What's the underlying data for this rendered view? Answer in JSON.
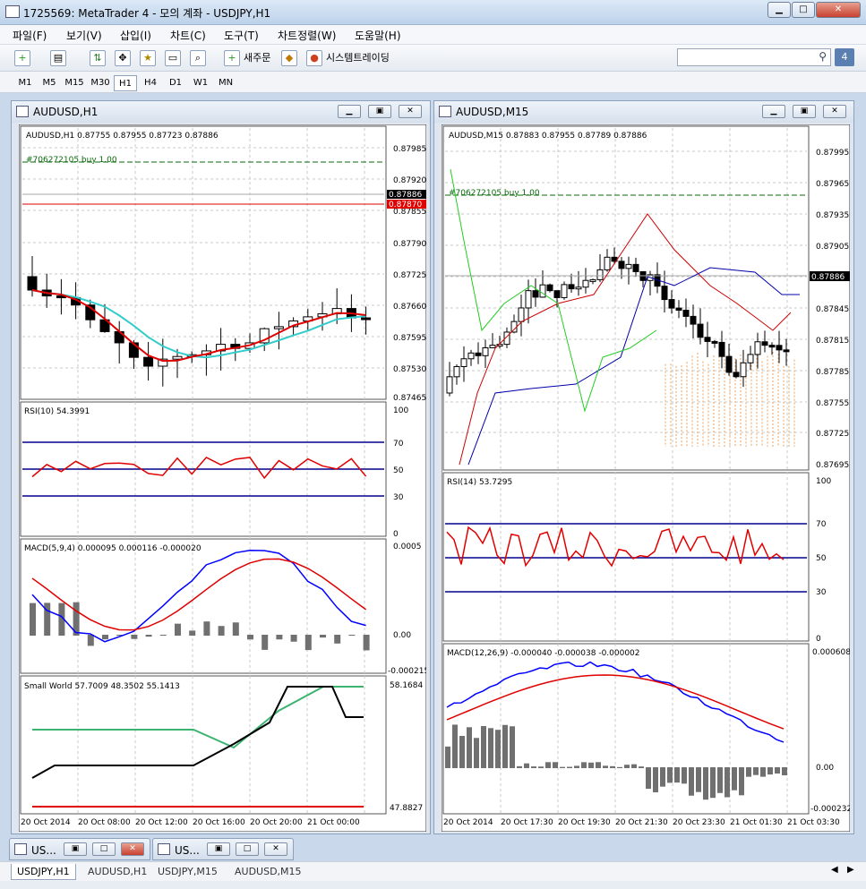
{
  "window": {
    "title": "1725569: MetaTrader 4 - 모의 계좌 - USDJPY,H1"
  },
  "menu": [
    "파일(F)",
    "보기(V)",
    "삽입(I)",
    "차트(C)",
    "도구(T)",
    "차트정렬(W)",
    "도움말(H)"
  ],
  "toolbar": {
    "new_order": "새주문",
    "auto_trading": "시스템트레이딩",
    "badge": "4"
  },
  "timeframes": [
    "M1",
    "M5",
    "M15",
    "M30",
    "H1",
    "H4",
    "D1",
    "W1",
    "MN"
  ],
  "active_timeframe": "H1",
  "colors": {
    "bull_candle": "#ffffff",
    "bear_candle": "#000000",
    "ma_fast": "#e00000",
    "ma_slow": "#33cccc",
    "rsi": "#e00000",
    "level": "#00008b",
    "macd_line": "#0000ff",
    "signal_line": "#e00000",
    "hist": "#707070",
    "small_world_fast": "#000000",
    "small_world_slow": "#3cb371"
  },
  "left_chart": {
    "title": "AUDUSD,H1",
    "header": "AUDUSD,H1  0.87755 0.87955 0.87723 0.87886",
    "order_label": "#706272105 buy 1.00",
    "order_price": 0.87955,
    "bid_price": "0.87886",
    "red_price": "0.87870",
    "price_ticks": [
      "0.87985",
      "0.87920",
      "0.87855",
      "0.87790",
      "0.87725",
      "0.87660",
      "0.87595",
      "0.87530",
      "0.87465"
    ],
    "rsi_header": "RSI(10) 54.3991",
    "rsi_ticks": [
      "100",
      "70",
      "50",
      "30",
      "0"
    ],
    "macd_header": "MACD(5,9,4) 0.000095 0.000116 -0.000020",
    "macd_ticks": [
      "0.0005",
      "0.00",
      "-0.000215"
    ],
    "sw_header": "Small World 57.7009 48.3502 55.1413",
    "sw_ticks": [
      "58.1684",
      "47.8827"
    ],
    "time_labels": [
      "20 Oct 2014",
      "20 Oct 08:00",
      "20 Oct 12:00",
      "20 Oct 16:00",
      "20 Oct 20:00",
      "21 Oct 00:00"
    ]
  },
  "right_chart": {
    "title": "AUDUSD,M15",
    "header": "AUDUSD,M15  0.87883 0.87955 0.87789 0.87886",
    "order_label": "#706272105 buy 1.00",
    "bid_price": "0.87886",
    "price_ticks": [
      "0.87995",
      "0.87965",
      "0.87935",
      "0.87905",
      "0.87875",
      "0.87845",
      "0.87815",
      "0.87785",
      "0.87755",
      "0.87725",
      "0.87695"
    ],
    "rsi_header": "RSI(14) 53.7295",
    "rsi_ticks": [
      "100",
      "70",
      "50",
      "30",
      "0"
    ],
    "macd_header": "MACD(12,26,9) -0.000040 -0.000038 -0.000002",
    "macd_ticks": [
      "0.000608",
      "0.00",
      "-0.000232"
    ],
    "time_labels": [
      "20 Oct 2014",
      "20 Oct 17:30",
      "20 Oct 19:30",
      "20 Oct 21:30",
      "20 Oct 23:30",
      "21 Oct 01:30",
      "21 Oct 03:30"
    ]
  },
  "minimized_windows": [
    "US...",
    "US..."
  ],
  "bottom_tabs": [
    "USDJPY,H1",
    "AUDUSD,H1",
    "USDJPY,M15",
    "AUDUSD,M15"
  ],
  "active_tab": "USDJPY,H1"
}
